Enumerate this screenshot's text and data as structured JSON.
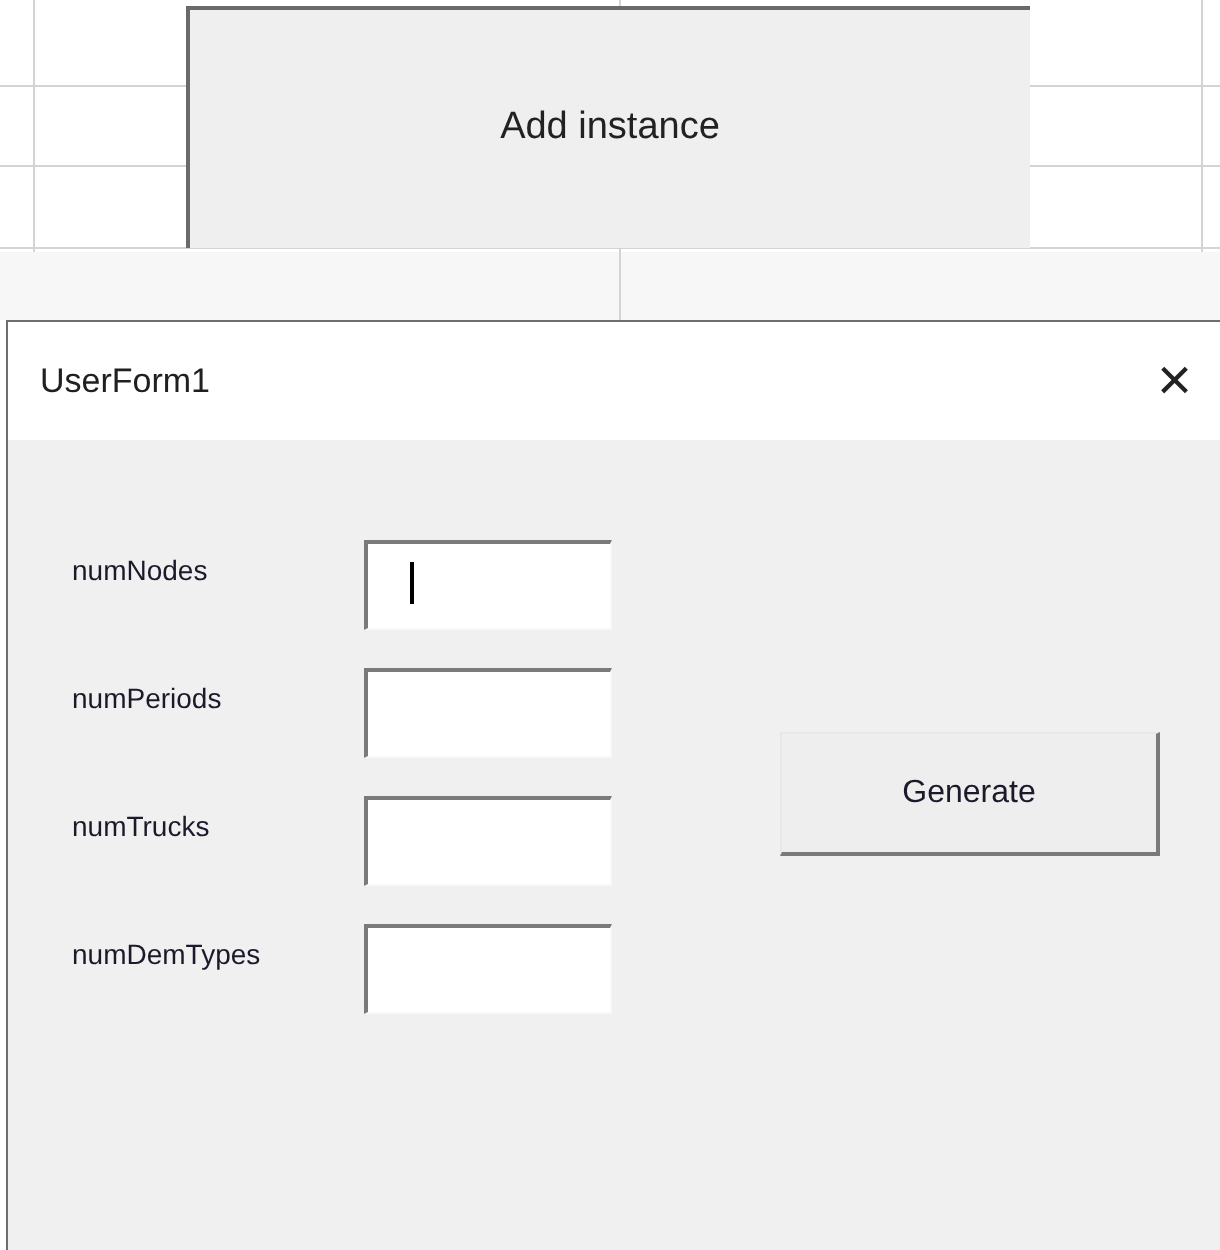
{
  "sheet_button": {
    "label": "Add instance"
  },
  "dialog": {
    "title": "UserForm1",
    "close": "×"
  },
  "fields": [
    {
      "label": "numNodes",
      "focused": true
    },
    {
      "label": "numPeriods",
      "focused": false
    },
    {
      "label": "numTrucks",
      "focused": false
    },
    {
      "label": "numDemTypes",
      "focused": false
    }
  ],
  "generate_button": {
    "label": "Generate"
  }
}
